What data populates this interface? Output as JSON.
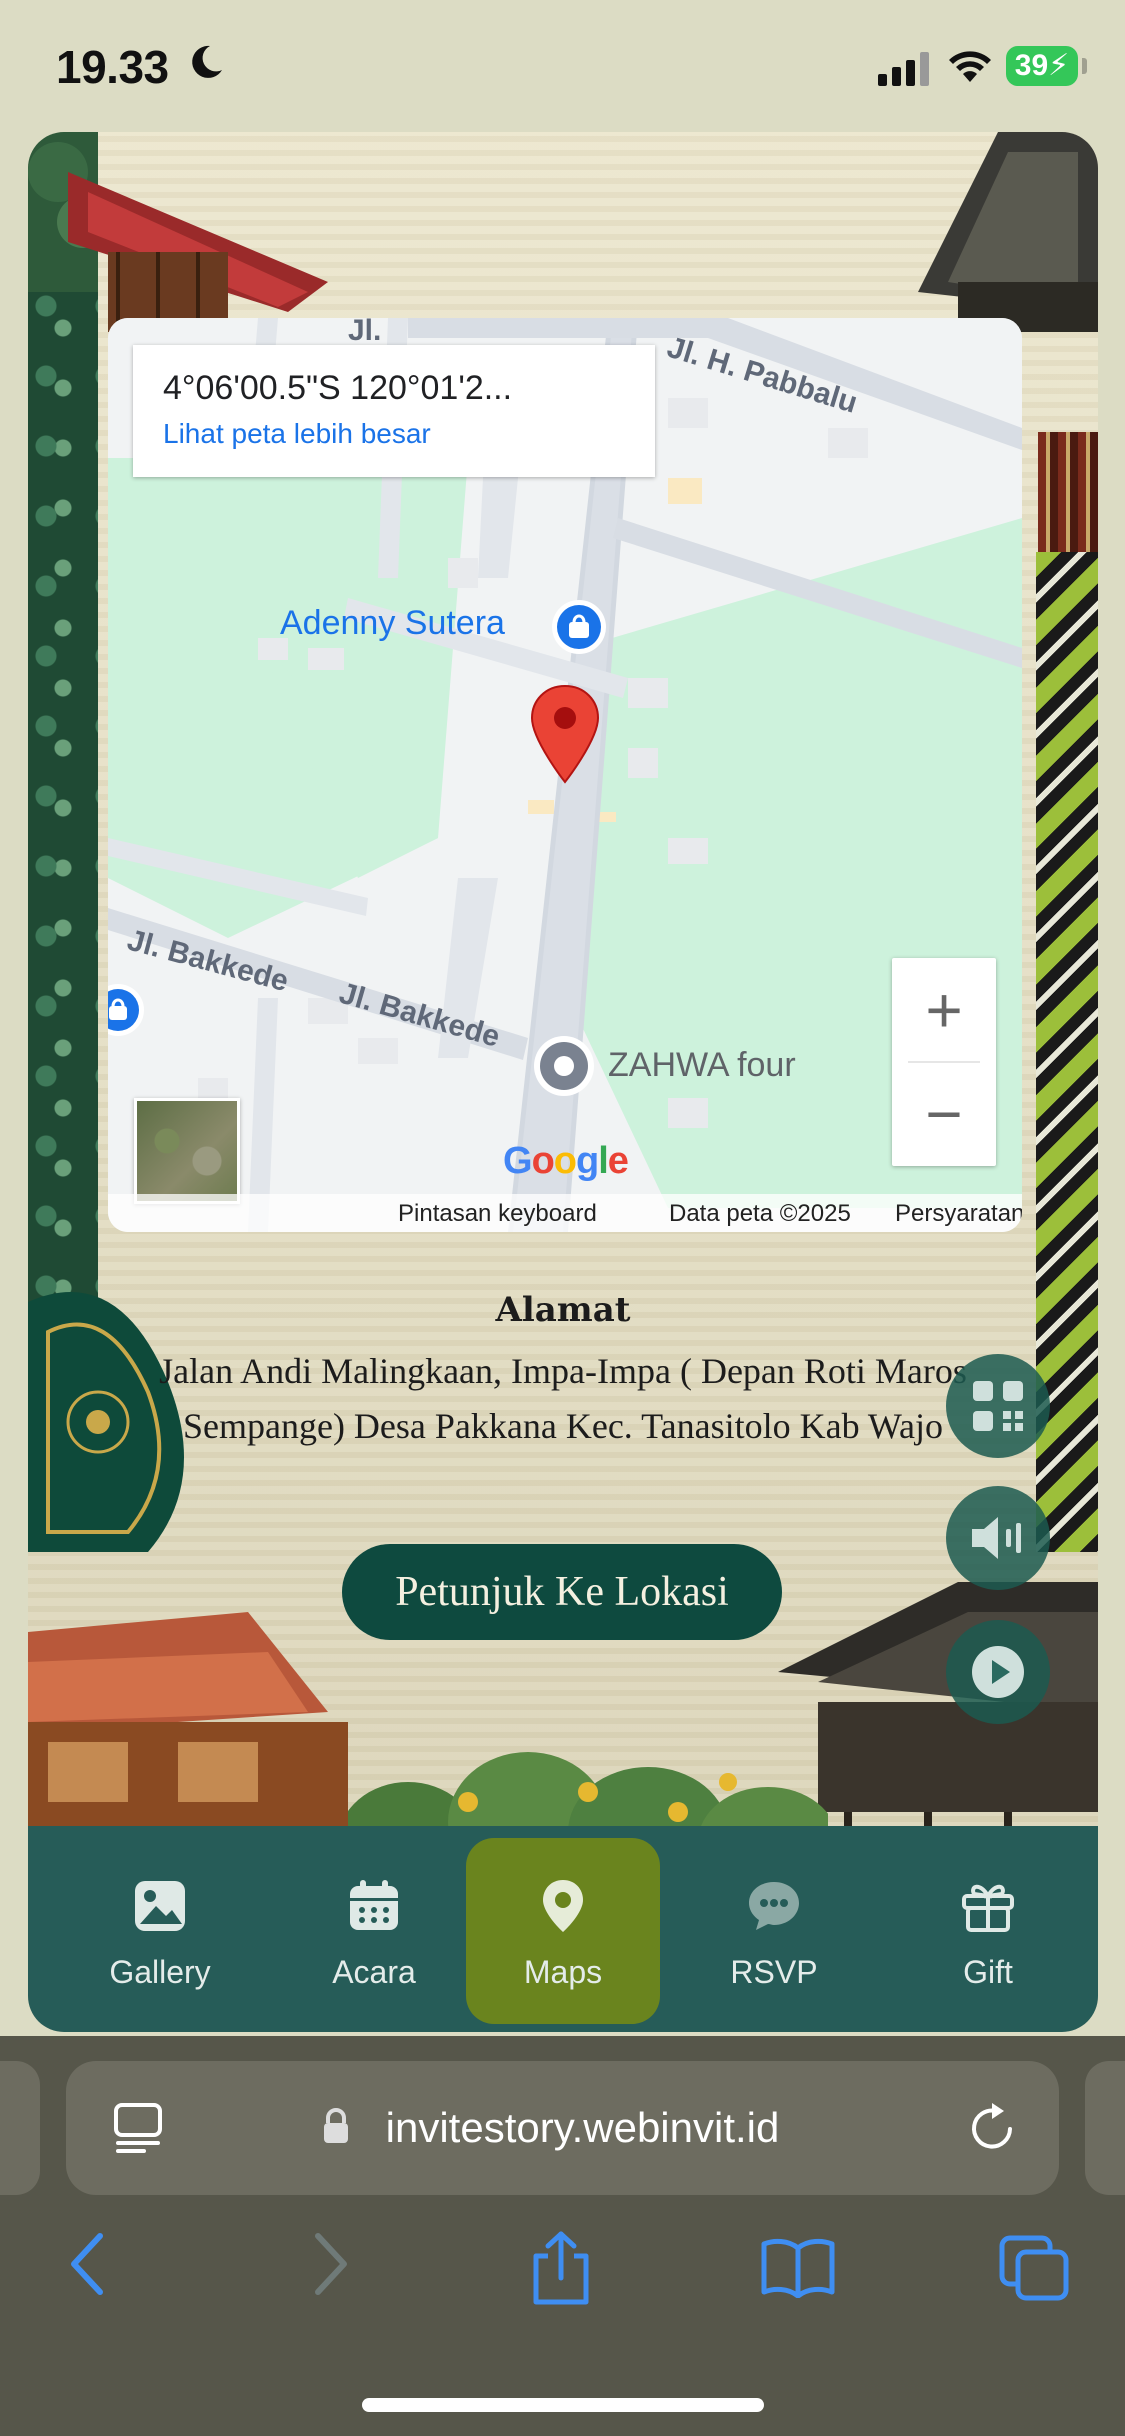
{
  "status_bar": {
    "time": "19.33",
    "battery": "39"
  },
  "map": {
    "coordinates": "4°06'00.5\"S 120°01'2...",
    "view_larger": "Lihat peta lebih besar",
    "streets": [
      "Jl. H. Pabbalu",
      "Jl. Bakkede",
      "Jl. Bakkede",
      "Jl."
    ],
    "pois": [
      "Adenny Sutera",
      "ZAHWA four"
    ],
    "zoom_in": "+",
    "zoom_out": "−",
    "logo": "Google",
    "footer": {
      "shortcuts": "Pintasan keyboard",
      "map_data": "Data peta ©2025",
      "terms": "Persyaratan"
    }
  },
  "address": {
    "title": "Alamat",
    "text": "Jalan Andi Malingkaan, Impa-Impa ( Depan Roti Maros Sempange) Desa Pakkana Kec. Tanasitolo Kab Wajo"
  },
  "direction_button": "Petunjuk Ke Lokasi",
  "nav": [
    {
      "label": "Gallery",
      "icon": "gallery-icon"
    },
    {
      "label": "Acara",
      "icon": "calendar-icon"
    },
    {
      "label": "Maps",
      "icon": "map-pin-icon",
      "active": true
    },
    {
      "label": "RSVP",
      "icon": "chat-icon"
    },
    {
      "label": "Gift",
      "icon": "gift-icon"
    }
  ],
  "browser": {
    "url": "invitestory.webinvit.id"
  },
  "colors": {
    "nav_bg": "#265c58",
    "nav_active": "#6a841e",
    "button_bg": "#0e4a3f",
    "browser_bg": "#56564a",
    "ios_blue": "#3f8ef2"
  }
}
